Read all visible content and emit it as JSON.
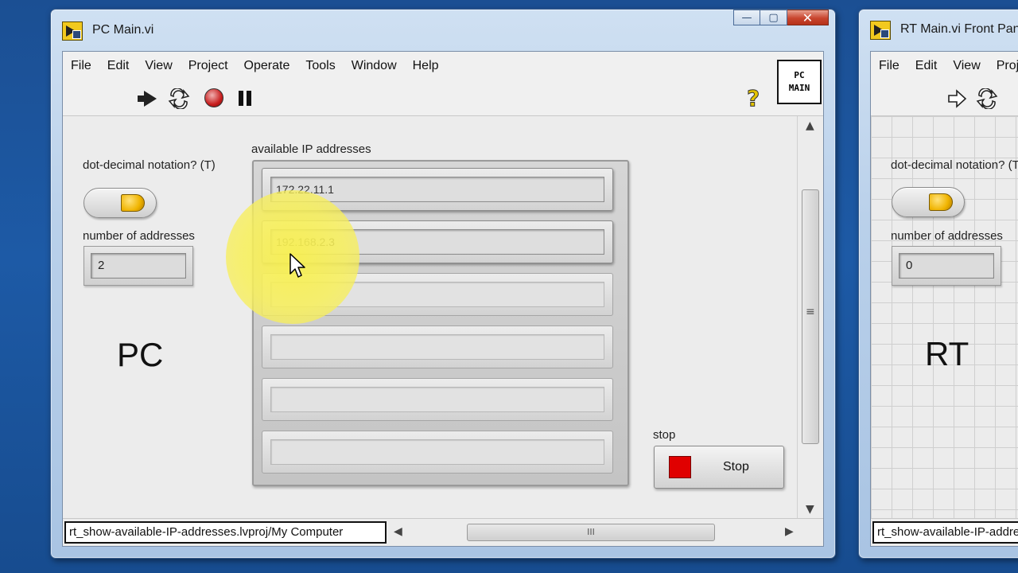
{
  "pc_window": {
    "title": "PC Main.vi",
    "menu": [
      "File",
      "Edit",
      "View",
      "Project",
      "Operate",
      "Tools",
      "Window",
      "Help"
    ],
    "vi_icon_text_line1": "PC",
    "vi_icon_text_line2": "MAIN",
    "help_glyph": "?",
    "toggle_label": "dot-decimal notation? (T)",
    "count_label": "number of addresses",
    "count_value": "2",
    "big_label": "PC",
    "array_label": "available IP addresses",
    "ip_addresses": [
      "172.22.11.1",
      "192.168.2.3",
      "",
      "",
      "",
      ""
    ],
    "stop_label": "stop",
    "stop_button_text": "Stop",
    "status_path": "rt_show-available-IP-addresses.lvproj/My Computer",
    "hscroll_grip": "III",
    "vscroll_grip": "≡"
  },
  "rt_window": {
    "title": "RT Main.vi Front Panel",
    "menu": [
      "File",
      "Edit",
      "View",
      "Proj"
    ],
    "toggle_label": "dot-decimal notation? (T)",
    "count_label": "number of addresses",
    "count_value": "0",
    "big_label": "RT",
    "status_path": "rt_show-available-IP-addresses.lvproj/RT Target"
  },
  "window_controls": {
    "minimize": "—",
    "maximize": "▢",
    "close": "✕"
  },
  "colors": {
    "desktop": "#1d5aa6",
    "highlight": "#f8f050",
    "stop_led": "#e00000",
    "toggle_knob": "#f0b400"
  }
}
